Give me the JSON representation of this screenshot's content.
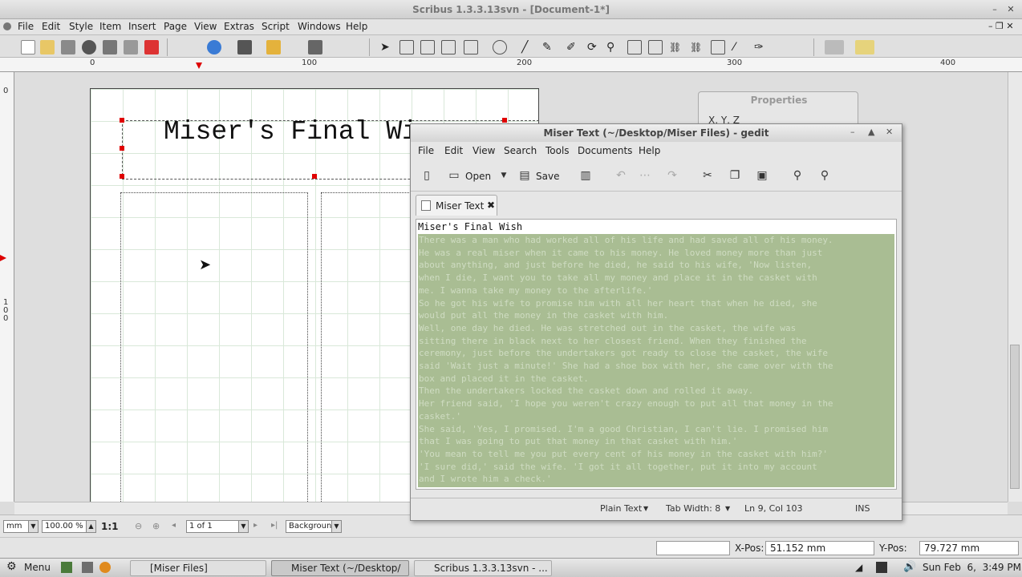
{
  "scribus": {
    "window_title": "Scribus 1.3.3.13svn - [Document-1*]",
    "menu": [
      "File",
      "Edit",
      "Style",
      "Item",
      "Insert",
      "Page",
      "View",
      "Extras",
      "Script",
      "Windows",
      "Help"
    ],
    "ruler_h_labels": [
      "0",
      "100",
      "200",
      "300",
      "400"
    ],
    "ruler_v_labels": [
      "0",
      "1",
      "0",
      "0"
    ],
    "title_frame_text": "Miser's Final Wi",
    "properties_title": "Properties",
    "properties_xyz": "X, Y, Z",
    "bottom": {
      "unit": "mm",
      "zoom": "100.00 %",
      "ratio": "1:1",
      "page_of": "1 of 1",
      "layer": "Background"
    },
    "status": {
      "xpos_label": "X-Pos:",
      "xpos_value": "51.152 mm",
      "ypos_label": "Y-Pos:",
      "ypos_value": "79.727 mm"
    }
  },
  "gedit": {
    "window_title": "Miser Text (~/Desktop/Miser Files) - gedit",
    "menu": [
      "File",
      "Edit",
      "View",
      "Search",
      "Tools",
      "Documents",
      "Help"
    ],
    "toolbar": {
      "open": "Open",
      "save": "Save"
    },
    "tab_label": "Miser Text",
    "first_line": "Miser's Final Wish",
    "selected_lines": [
      "There was a man who had worked all of his life and had saved all of his money.",
      "He was a real miser when it came to his money. He loved money more than just",
      "about anything, and just before he died, he said to his wife, 'Now listen,",
      "when I die, I want you to take all my money and place it in the casket with",
      "me. I wanna take my money to the afterlife.'",
      "So he got his wife to promise him with all her heart that when he died, she",
      "would put all the money in the casket with him.",
      "Well, one day he died. He was stretched out in the casket, the wife was",
      "sitting there in black next to her closest friend. When they finished the",
      "ceremony, just before the undertakers got ready to close the casket, the wife",
      "said 'Wait just a minute!' She had a shoe box with her, she came over with the",
      "box and placed it in the casket.",
      "Then the undertakers locked the casket down and rolled it away.",
      "Her friend said, 'I hope you weren't crazy enough to put all that money in the",
      "casket.'",
      "She said, 'Yes, I promised. I'm a good Christian, I can't lie. I promised him",
      "that I was going to put that money in that casket with him.'",
      "'You mean to tell me you put every cent of his money in the casket with him?'",
      "'I sure did,' said the wife. 'I got it all together, put it into my account",
      "and I wrote him a check.'"
    ],
    "status": {
      "mode": "Plain Text",
      "tab_width": "Tab Width: 8",
      "position": "Ln 9, Col 103",
      "ins": "INS"
    }
  },
  "taskbar": {
    "menu_label": "Menu",
    "tasks": [
      "[Miser Files]",
      "Miser Text (~/Desktop/",
      "Scribus 1.3.3.13svn - ..."
    ],
    "clock": "Sun Feb  6,  3:49 PM"
  },
  "colors": {
    "selection": "#a9bd93",
    "handle": "#e00000",
    "grid": "#d9e8d9"
  }
}
